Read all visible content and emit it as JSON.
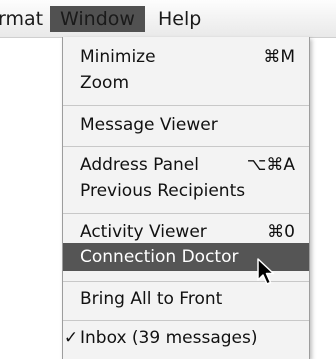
{
  "menubar": {
    "format_label": "rmat",
    "window_label": "Window",
    "help_label": "Help"
  },
  "window_menu": {
    "items": [
      {
        "label": "Minimize",
        "shortcut": "⌘M"
      },
      {
        "label": "Zoom",
        "shortcut": ""
      },
      {
        "label": "Message Viewer",
        "shortcut": ""
      },
      {
        "label": "Address Panel",
        "shortcut": "⌥⌘A"
      },
      {
        "label": "Previous Recipients",
        "shortcut": ""
      },
      {
        "label": "Activity Viewer",
        "shortcut": "⌘0"
      },
      {
        "label": "Connection Doctor",
        "shortcut": ""
      },
      {
        "label": "Bring All to Front",
        "shortcut": ""
      },
      {
        "label": "Inbox (39 messages)",
        "shortcut": "",
        "checkmark": "✓"
      }
    ],
    "highlighted_item": "Connection Doctor"
  },
  "colors": {
    "highlight": "#555555",
    "menu_background": "#f3f3f3"
  },
  "cursor": {
    "icon": "arrow-cursor-icon"
  }
}
